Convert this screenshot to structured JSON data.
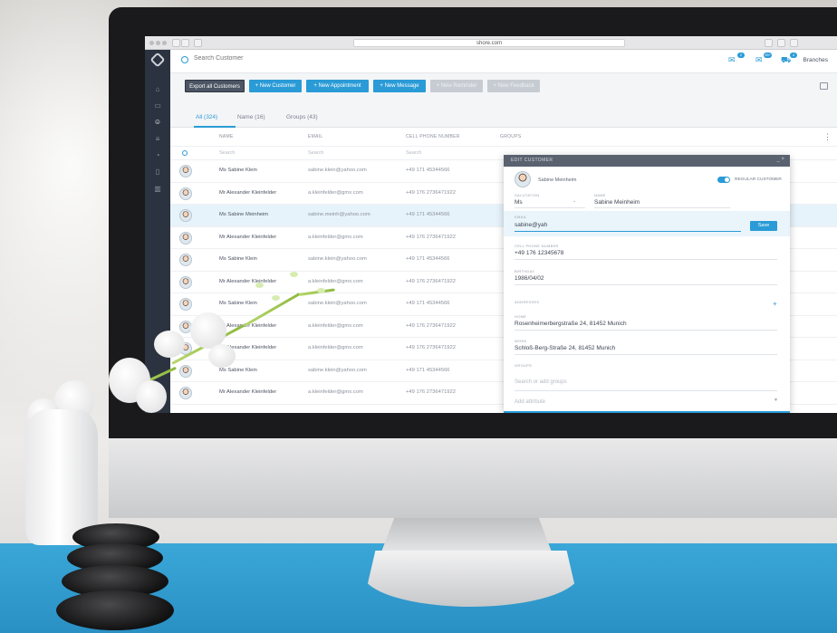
{
  "browser": {
    "url": "shore.com"
  },
  "header": {
    "search_placeholder": "Search Customer",
    "badges": [
      "2",
      "99+",
      "4"
    ],
    "branches_label": "Branches"
  },
  "toolbar": {
    "export": "Export all Customers",
    "new_customer": "+ New Customer",
    "new_appointment": "+ New Appointment",
    "new_message": "+ New Message",
    "new_reminder": "+ New Reminder",
    "new_feedback": "+ New Feedback"
  },
  "tabs": [
    {
      "label": "All (324)"
    },
    {
      "label": "Name (16)"
    },
    {
      "label": "Groups (43)"
    }
  ],
  "table": {
    "columns": [
      "Name",
      "Email",
      "Cell phone number",
      "Groups"
    ],
    "filter_placeholders": [
      "Search",
      "Search",
      "Search"
    ],
    "rows": [
      {
        "name": "Ms Sabine Klein",
        "email": "sabine.klein@yahoo.com",
        "phone": "+49 171 45344566"
      },
      {
        "name": "Mr Alexander Kleinfelder",
        "email": "a.kleinfelder@gmx.com",
        "phone": "+49 176 2736471922"
      },
      {
        "name": "Ms Sabine Meinheim",
        "email": "sabine.meinh@yahoo.com",
        "phone": "+49 171 45344566"
      },
      {
        "name": "Mr Alexander Kleinfelder",
        "email": "a.kleinfelder@gmx.com",
        "phone": "+49 176 2736471922"
      },
      {
        "name": "Ms Sabine Klein",
        "email": "sabine.klein@yahoo.com",
        "phone": "+49 171 45344566"
      },
      {
        "name": "Mr Alexander Kleinfelder",
        "email": "a.kleinfelder@gmx.com",
        "phone": "+49 176 2736471922"
      },
      {
        "name": "Ms Sabine Klein",
        "email": "sabine.klein@yahoo.com",
        "phone": "+49 171 45344566"
      },
      {
        "name": "Mr Alexander Kleinfelder",
        "email": "a.kleinfelder@gmx.com",
        "phone": "+49 176 2736471922"
      },
      {
        "name": "Mr Alexander Kleinfelder",
        "email": "a.kleinfelder@gmx.com",
        "phone": "+49 176 2736471922"
      },
      {
        "name": "Ms Sabine Klein",
        "email": "sabine.klein@yahoo.com",
        "phone": "+49 171 45344566"
      },
      {
        "name": "Mr Alexander Kleinfelder",
        "email": "a.kleinfelder@gmx.com",
        "phone": "+49 176 2736471922"
      }
    ]
  },
  "panel": {
    "title": "Edit customer",
    "controls": "_ ×",
    "customer_name": "Sabine Meinheim",
    "regular_customer_label": "Regular customer",
    "salutation_label": "Salutation",
    "salutation_value": "Ms",
    "name_label": "Name",
    "name_value": "Sabine Meinheim",
    "email_label": "Email",
    "email_value": "sabine@yah",
    "save_label": "Save",
    "phone_label": "Cell phone number",
    "phone_value": "+49 176 12345678",
    "birthday_label": "Birthday",
    "birthday_value": "1986/04/02",
    "addresses_label": "Addresses",
    "home_label": "Home",
    "home_value": "Rosenheimerbergstraße 24, 81452 Munich",
    "work_label": "Work",
    "work_value": "Schloß-Berg-Straße 24, 81452 Munich",
    "groups_label": "Groups",
    "groups_placeholder": "Search or add groups",
    "add_attribute": "Add attribute"
  },
  "colors": {
    "accent": "#2a9bd6",
    "sidebar": "#2c3340",
    "toolbar_dark": "#4c5563"
  }
}
